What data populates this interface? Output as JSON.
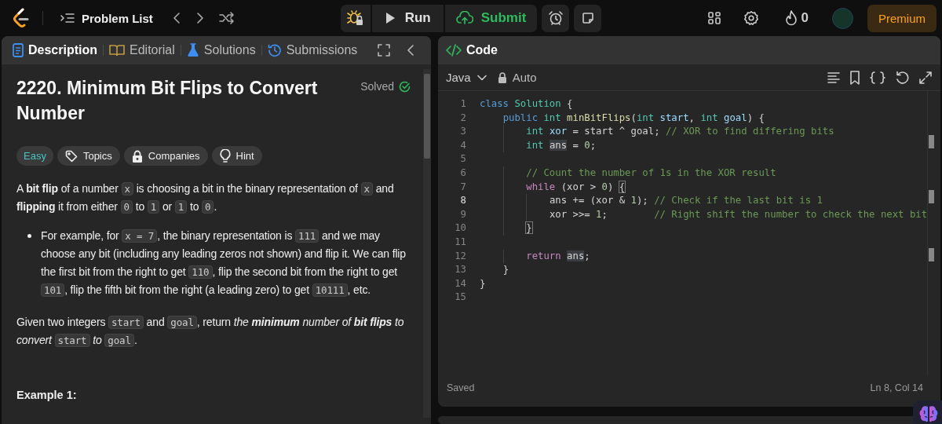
{
  "topbar": {
    "nav_label": "Problem List",
    "run": "Run",
    "submit": "Submit",
    "streak": "0",
    "premium": "Premium"
  },
  "left_tabs": [
    {
      "label": "Description",
      "selected": true,
      "kind": "doc"
    },
    {
      "label": "Editorial",
      "selected": false,
      "kind": "book"
    },
    {
      "label": "Solutions",
      "selected": false,
      "kind": "flask"
    },
    {
      "label": "Submissions",
      "selected": false,
      "kind": "history"
    }
  ],
  "problem": {
    "title": "2220. Minimum Bit Flips to Convert Number",
    "status": "Solved",
    "difficulty": "Easy",
    "tags": [
      {
        "label": "Topics",
        "kind": "tag"
      },
      {
        "label": "Companies",
        "kind": "lock"
      },
      {
        "label": "Hint",
        "kind": "bulb"
      }
    ],
    "paragraphs": [
      {
        "kind": "para",
        "segments": [
          {
            "kind": "text",
            "text": "A **bit flip** of a number "
          },
          {
            "kind": "code",
            "text": "x"
          },
          {
            "kind": "text",
            "text": " is choosing a bit in the binary representation of "
          },
          {
            "kind": "code",
            "text": "x"
          },
          {
            "kind": "text",
            "text": " and **flipping** it from either "
          },
          {
            "kind": "code",
            "text": "0"
          },
          {
            "kind": "text",
            "text": " to "
          },
          {
            "kind": "code",
            "text": "1"
          },
          {
            "kind": "text",
            "text": " or "
          },
          {
            "kind": "code",
            "text": "1"
          },
          {
            "kind": "text",
            "text": " to "
          },
          {
            "kind": "code",
            "text": "0"
          },
          {
            "kind": "text",
            "text": "."
          }
        ]
      },
      {
        "kind": "bullet",
        "segments": [
          {
            "kind": "text",
            "text": "For example, for "
          },
          {
            "kind": "code",
            "text": "x = 7"
          },
          {
            "kind": "text",
            "text": ", the binary representation is "
          },
          {
            "kind": "code",
            "text": "111"
          },
          {
            "kind": "text",
            "text": " and we may choose any bit (including any leading zeros not shown) and flip it. We can flip the first bit from the right to get "
          },
          {
            "kind": "code",
            "text": "110"
          },
          {
            "kind": "text",
            "text": ", flip the second bit from the right to get "
          },
          {
            "kind": "code",
            "text": "101"
          },
          {
            "kind": "text",
            "text": ", flip the fifth bit from the right (a leading zero) to get "
          },
          {
            "kind": "code",
            "text": "10111"
          },
          {
            "kind": "text",
            "text": ", etc."
          }
        ]
      },
      {
        "kind": "para",
        "segments": [
          {
            "kind": "text",
            "text": "Given two integers "
          },
          {
            "kind": "code",
            "text": "start"
          },
          {
            "kind": "text",
            "text": " and "
          },
          {
            "kind": "code",
            "text": "goal"
          },
          {
            "kind": "text",
            "text": ", return "
          },
          {
            "kind": "em",
            "text": "the **minimum** number of **bit flips** to convert "
          },
          {
            "kind": "code",
            "text": "start"
          },
          {
            "kind": "em",
            "text": " to "
          },
          {
            "kind": "code",
            "text": "goal"
          },
          {
            "kind": "text",
            "text": "."
          }
        ]
      }
    ],
    "example_heading": "Example 1:"
  },
  "editor": {
    "title": "Code",
    "language": "Java",
    "mode": "Auto",
    "status": "Saved",
    "cursor": "Ln 8, Col 14",
    "lines": [
      {
        "number": "1",
        "current": false,
        "tokens": [
          {
            "kind": "kw",
            "text": "class "
          },
          {
            "kind": "type",
            "text": "Solution"
          },
          {
            "kind": "pl",
            "text": " {"
          }
        ]
      },
      {
        "number": "2",
        "current": false,
        "tokens": [
          {
            "kind": "kw",
            "text": "    public "
          },
          {
            "kind": "type",
            "text": "int "
          },
          {
            "kind": "fn",
            "text": "minBitFlips"
          },
          {
            "kind": "pl",
            "text": "("
          },
          {
            "kind": "type",
            "text": "int "
          },
          {
            "kind": "var",
            "text": "start"
          },
          {
            "kind": "pl",
            "text": ", "
          },
          {
            "kind": "type",
            "text": "int "
          },
          {
            "kind": "var",
            "text": "goal"
          },
          {
            "kind": "pl",
            "text": ") {"
          }
        ]
      },
      {
        "number": "3",
        "current": false,
        "tokens": [
          {
            "kind": "type",
            "text": "        int "
          },
          {
            "kind": "var",
            "text": "xor"
          },
          {
            "kind": "pl",
            "text": " = start ^ goal; "
          },
          {
            "kind": "cm",
            "text": "// XOR to find differing bits"
          }
        ]
      },
      {
        "number": "4",
        "current": false,
        "tokens": [
          {
            "kind": "type",
            "text": "        int "
          },
          {
            "kind": "hl",
            "text": "ans"
          },
          {
            "kind": "pl",
            "text": " = "
          },
          {
            "kind": "num",
            "text": "0"
          },
          {
            "kind": "pl",
            "text": ";"
          }
        ]
      },
      {
        "number": "5",
        "current": false
      },
      {
        "number": "6",
        "current": false,
        "tokens": [
          {
            "kind": "cm",
            "text": "        // Count the number of 1s in the XOR result"
          }
        ]
      },
      {
        "number": "7",
        "current": false,
        "tokens": [
          {
            "kind": "ctrl",
            "text": "        while"
          },
          {
            "kind": "pl",
            "text": " (xor > "
          },
          {
            "kind": "num",
            "text": "0"
          },
          {
            "kind": "pl",
            "text": ") "
          },
          {
            "kind": "br",
            "text": "{"
          }
        ]
      },
      {
        "number": "8",
        "current": true,
        "tokens": [
          {
            "kind": "pl",
            "text": "            ans += (xor & "
          },
          {
            "kind": "num",
            "text": "1"
          },
          {
            "kind": "pl",
            "text": "); "
          },
          {
            "kind": "cm",
            "text": "// Check if the last bit is 1"
          }
        ]
      },
      {
        "number": "9",
        "current": false,
        "tokens": [
          {
            "kind": "pl",
            "text": "            xor >>= "
          },
          {
            "kind": "num",
            "text": "1"
          },
          {
            "kind": "pl",
            "text": ";        "
          },
          {
            "kind": "cm",
            "text": "// Right shift the number to check the next bit"
          }
        ]
      },
      {
        "number": "10",
        "current": false,
        "tokens": [
          {
            "kind": "br",
            "text": "        }"
          }
        ]
      },
      {
        "number": "11",
        "current": false
      },
      {
        "number": "12",
        "current": false,
        "tokens": [
          {
            "kind": "ctrl",
            "text": "        return "
          },
          {
            "kind": "hl",
            "text": "ans"
          },
          {
            "kind": "pl",
            "text": ";"
          }
        ]
      },
      {
        "number": "13",
        "current": false,
        "tokens": [
          {
            "kind": "pl",
            "text": "    }"
          }
        ]
      },
      {
        "number": "14",
        "current": false,
        "tokens": [
          {
            "kind": "pl",
            "text": "}"
          }
        ]
      },
      {
        "number": "15",
        "current": false
      }
    ]
  }
}
